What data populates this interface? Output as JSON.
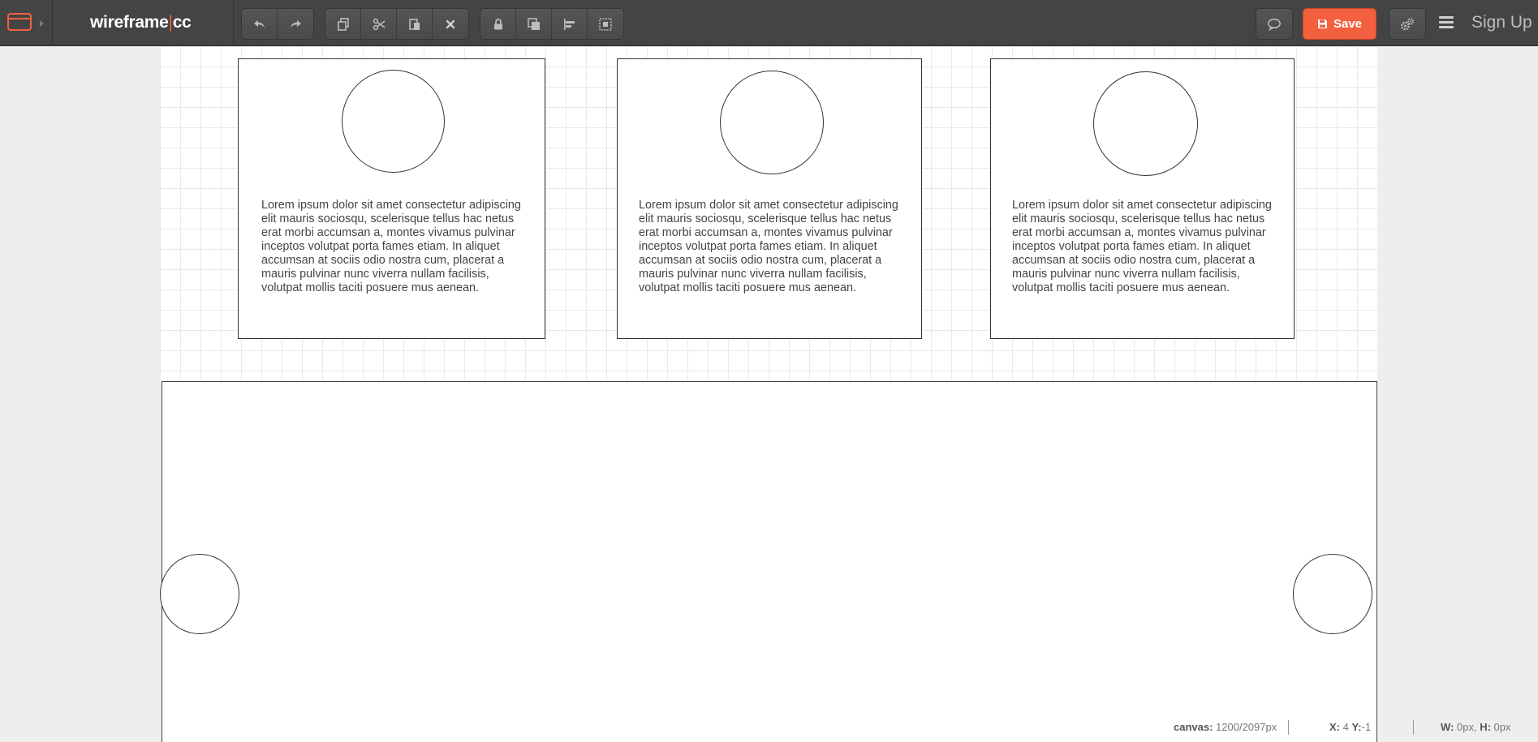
{
  "app": {
    "logo_left": "wireframe",
    "logo_bar": "|",
    "logo_right": "cc",
    "accent_color": "#f2603f"
  },
  "toolbar": {
    "history_icons": [
      "undo-icon",
      "redo-icon"
    ],
    "clipboard_icons": [
      "copy-icon",
      "cut-icon",
      "paste-icon",
      "delete-icon"
    ],
    "arrange_icons": [
      "lock-icon",
      "layer-order-icon",
      "align-icon",
      "group-icon"
    ],
    "comment_icon": "comment-icon",
    "save_label": "Save",
    "save_icon": "floppy-disk-icon",
    "settings_icon": "gears-icon",
    "menu_icon": "hamburger-menu-icon",
    "signup_label": "Sign Up"
  },
  "canvas": {
    "cards": [
      {
        "text": "Lorem ipsum dolor sit amet consectetur adipiscing elit mauris sociosqu, scelerisque tellus hac netus erat morbi accumsan a, montes vivamus pulvinar inceptos volutpat porta fames etiam. In aliquet accumsan at sociis odio nostra cum, placerat a mauris pulvinar nunc viverra nullam facilisis, volutpat mollis taciti posuere mus aenean."
      },
      {
        "text": "Lorem ipsum dolor sit amet consectetur adipiscing elit mauris sociosqu, scelerisque tellus hac netus erat morbi accumsan a, montes vivamus pulvinar inceptos volutpat porta fames etiam. In aliquet accumsan at sociis odio nostra cum, placerat a mauris pulvinar nunc viverra nullam facilisis, volutpat mollis taciti posuere mus aenean."
      },
      {
        "text": "Lorem ipsum dolor sit amet consectetur adipiscing elit mauris sociosqu, scelerisque tellus hac netus erat morbi accumsan a, montes vivamus pulvinar inceptos volutpat porta fames etiam. In aliquet accumsan at sociis odio nostra cum, placerat a mauris pulvinar nunc viverra nullam facilisis, volutpat mollis taciti posuere mus aenean."
      }
    ]
  },
  "status": {
    "canvas_label": "canvas:",
    "canvas_value": "1200/2097px",
    "x_label": "X:",
    "x_value": "4",
    "y_label": "Y:",
    "y_value": "-1",
    "w_label": "W:",
    "w_value": "0px,",
    "h_label": "H:",
    "h_value": "0px"
  }
}
